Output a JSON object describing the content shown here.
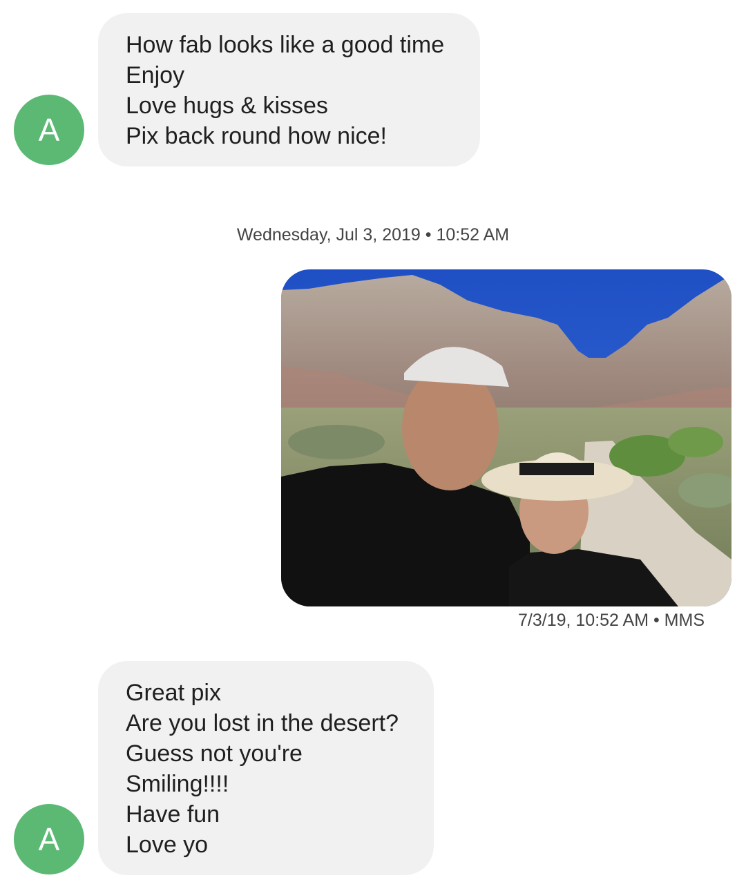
{
  "conversation": {
    "contact_initial": "A",
    "avatar_color": "#5bb974",
    "messages": [
      {
        "lines": [
          "How fab looks like a good time",
          "Enjoy",
          "Love hugs & kisses",
          "Pix back round how nice!"
        ]
      },
      {
        "lines": [
          "Great pix",
          "Are you lost in the desert?",
          "Guess not you're",
          "Smiling!!!!",
          "Have fun",
          "Love yo"
        ]
      }
    ],
    "date_divider": "Wednesday, Jul 3, 2019 • 10:52 AM",
    "sent_photo": {
      "meta": "7/3/19, 10:52 AM • MMS"
    }
  }
}
